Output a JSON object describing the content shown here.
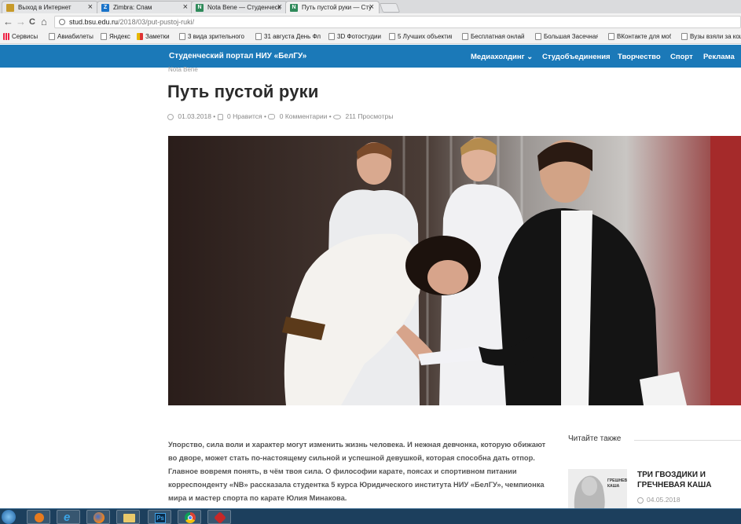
{
  "browser": {
    "tabs": [
      {
        "label": "Выход в Интернет",
        "favicon": "globe-icon"
      },
      {
        "label": "Zimbra: Спам",
        "favicon": "zimbra-icon"
      },
      {
        "label": "Nota Bene — Студенческ",
        "favicon": "nb-icon"
      },
      {
        "label": "Путь пустой руки — Сту",
        "favicon": "nb-icon"
      }
    ],
    "tab_close": "×",
    "url_host": "stud.bsu.edu.ru",
    "url_path": "/2018/03/put-pustoj-ruki/",
    "nav": {
      "back": "←",
      "forward": "→",
      "reload": "C",
      "home": "⌂"
    },
    "bookmarks": [
      "Сервисы",
      "Авиабилеты",
      "Яндекс",
      "Заметки",
      "3 вида зрительного",
      "31 августа День Фл",
      "3D Фотостудии",
      "5 Лучших объектив",
      "Бесплатная онлайн",
      "Большая Засечная",
      "ВКонтакте для моб",
      "Вузы взяли за кош"
    ]
  },
  "site": {
    "logo": "Студенческий портал НИУ «БелГУ»",
    "menu": [
      {
        "label": "Медиахолдинг ⌄"
      },
      {
        "label": "Студобъединения"
      },
      {
        "label": "Творчество"
      },
      {
        "label": "Спорт"
      },
      {
        "label": "Реклама"
      }
    ]
  },
  "article": {
    "category": "Nota Bene",
    "title": "Путь пустой руки",
    "date": "01.03.2018",
    "likes": "0 Нравится",
    "comments": "0 Комментарии",
    "views": "211 Просмотры",
    "lead": "Упорство, сила воли и характер могут изменить жизнь человека. И нежная девчонка, которую обижают во дворе, может стать по-настоящему сильной и успешной девушкой, которая способна дать отпор. Главное вовремя понять, в чём твоя сила. О философии карате, поясах и спортивном питании корреспонденту «NB» рассказала студентка 5 курса Юридического института НИУ «БелГУ», чемпионка мира и мастер спорта по карате Юлия Минакова."
  },
  "sidebar": {
    "heading": "Читайте также",
    "related": {
      "title": "Три гвоздики и гречневая каша",
      "date": "04.05.2018",
      "thumb_text": "ГРЕШНЕВ КАША"
    }
  },
  "taskbar": {
    "apps": [
      "start-orb",
      "media-player",
      "internet-explorer",
      "firefox",
      "file-explorer",
      "photoshop",
      "chrome",
      "app"
    ],
    "ps_label": "Ps"
  }
}
